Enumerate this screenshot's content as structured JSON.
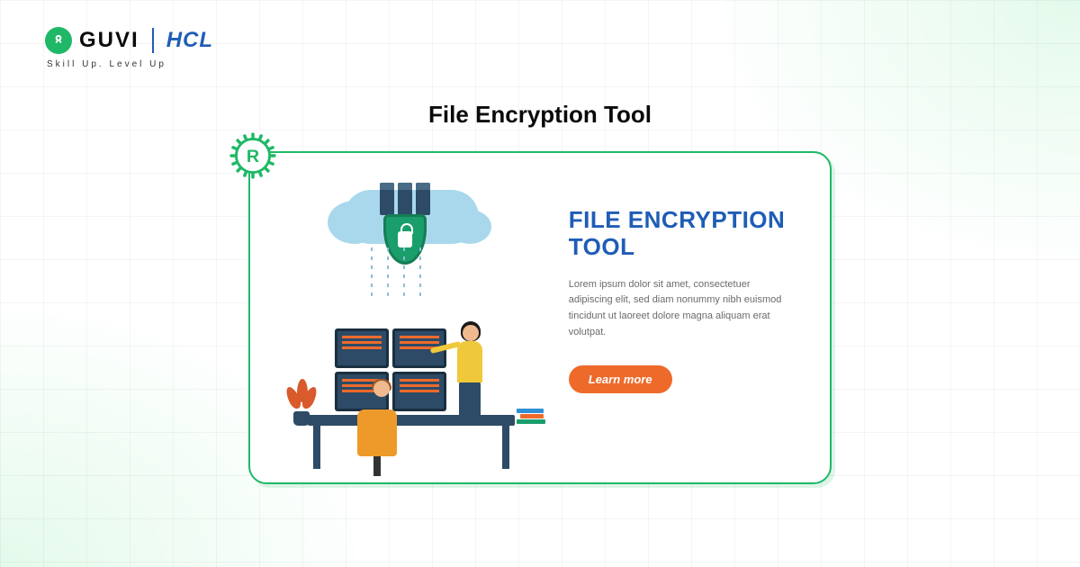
{
  "header": {
    "guvi_name": "GUVI",
    "hcl_name": "HCL",
    "tagline": "Skill Up. Level Up"
  },
  "page": {
    "title": "File Encryption Tool"
  },
  "card": {
    "badge": "R",
    "title": "FILE ENCRYPTION TOOL",
    "description": "Lorem ipsum dolor sit amet, consectetuer adipiscing elit, sed diam nonummy nibh euismod tincidunt ut laoreet dolore magna aliquam erat volutpat.",
    "cta_label": "Learn more"
  },
  "colors": {
    "accent_green": "#1fb866",
    "brand_blue": "#1f5db6",
    "cta_orange": "#ee6a2b"
  }
}
